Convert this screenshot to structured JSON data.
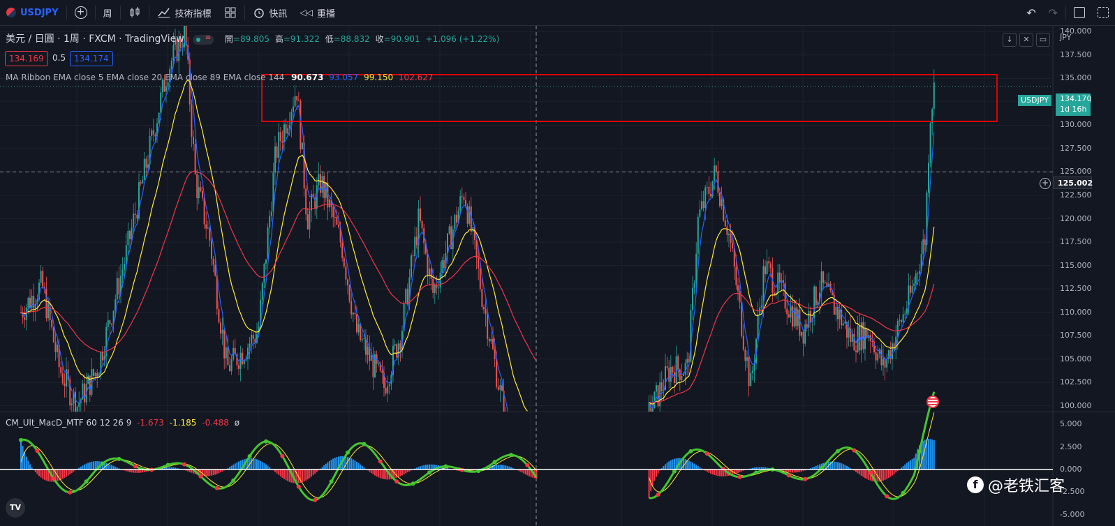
{
  "toolbar": {
    "symbol": "USDJPY",
    "interval": "周",
    "indicators": "技術指標",
    "alerts": "快訊",
    "replay": "重播"
  },
  "legend": {
    "title": "美元 / 日圓 · 1周 · FXCM · TradingView",
    "ohlc": {
      "open_label": "開",
      "open": "=89.805",
      "high_label": "高",
      "high": "=91.322",
      "low_label": "低",
      "low": "=88.832",
      "close_label": "收",
      "close": "=90.901",
      "change": "+1.096 (+1.22%)"
    },
    "bid": "134.169",
    "spread": "0.5",
    "ask": "134.174"
  },
  "ribbon": {
    "name": "MA Ribbon EMA close 5 EMA close 20 EMA close 89 EMA close 144",
    "v1": "90.673",
    "v2": "93.057",
    "v3": "99.150",
    "v4": "102.627"
  },
  "macd": {
    "name": "CM_Ult_MacD_MTF 60 12 26 9",
    "v1": "-1.673",
    "v2": "-1.185",
    "v3": "-0.488",
    "v4": "ø"
  },
  "price_axis": {
    "currency": "JPY",
    "ticks": [
      "140.000",
      "137.500",
      "135.000",
      "132.500",
      "130.000",
      "127.500",
      "125.000",
      "122.500",
      "120.000",
      "117.500",
      "115.000",
      "112.500",
      "110.000",
      "107.500",
      "105.000",
      "102.500",
      "100.000"
    ],
    "current_symbol": "USDJPY",
    "current_price": "134.170",
    "countdown": "1d 16h",
    "crosshair_price": "125.002"
  },
  "macd_axis": {
    "ticks": [
      "5.000",
      "2.500",
      "0.000",
      "-2.500",
      "-5.000"
    ]
  },
  "watermark": "@老铁汇客",
  "colors": {
    "bg": "#131722",
    "up": "#26a69a",
    "down": "#ef5350",
    "ema5": "#2962ff",
    "ema20": "#ffeb3b",
    "ema89": "#f23645",
    "highlight": "#e00000"
  }
}
